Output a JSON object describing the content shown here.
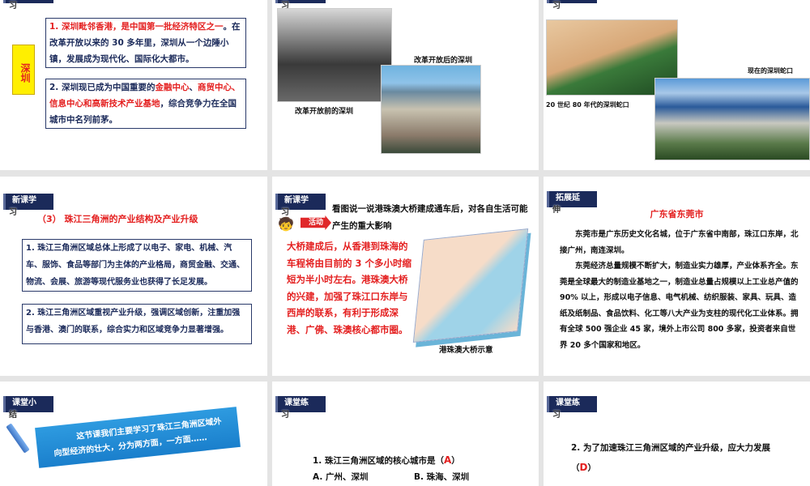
{
  "slide1": {
    "badge2": "习",
    "side_label": "深圳",
    "p1_red": "1. 深圳毗邻香港，是中国第一批经济特区之一",
    "p1_rest": "。在改革开放以来的 30 多年里，深圳从一个边陲小镇，发展成为现代化、国际化大都市。",
    "p2_a": "2. 深圳现已成为中国重要的",
    "p2_red1": "金融中心",
    "p2_b": "、",
    "p2_red2": "商贸中心、信息中心和高新技术产业基地",
    "p2_c": "，综合竞争力在全国城市中名列前茅。"
  },
  "slide2": {
    "badge2": "习",
    "cap_before": "改革开放前的深圳",
    "cap_after": "改革开放后的深圳"
  },
  "slide3": {
    "badge2": "习",
    "cap_80s": "20 世纪 80 年代的深圳蛇口",
    "cap_now": "现在的深圳蛇口"
  },
  "slide4": {
    "badge1": "新课学",
    "badge2": "习",
    "title": "（3） 珠江三角洲的产业结构及产业升级",
    "p1": "1. 珠江三角洲区域总体上形成了以电子、家电、机械、汽车、服饰、食品等部门为主体的产业格局，商贸金融、交通、物流、会展、旅游等现代服务业也获得了长足发展。",
    "p2": "2. 珠江三角洲区域重视产业升级，强调区域创新，注重加强与香港、澳门的联系，综合实力和区域竞争力显著增强。"
  },
  "slide5": {
    "badge1": "新课学",
    "badge2": "习",
    "activity": "活动",
    "prompt": "看图说一说港珠澳大桥建成通车后，对各自生活可能产生的重大影响",
    "answer": "大桥建成后，从香港到珠海的车程将由目前的 3 个多小时缩短为半小时左右。港珠澳大桥的兴建，加强了珠江口东岸与西岸的联系，有利于形成深港、广佛、珠澳核心都市圈。",
    "map_caption": "港珠澳大桥示意"
  },
  "slide6": {
    "badge1": "拓展延",
    "badge2": "伸",
    "title": "广东省东莞市",
    "p1": "东莞市是广东历史文化名城，位于广东省中南部，珠江口东岸，北接广州，南连深圳。",
    "p2": "东莞经济总量规模不断扩大，制造业实力雄厚，产业体系齐全。东莞是全球最大的制造业基地之一，制造业总量占规模以上工业总产值的 90% 以上，形成以电子信息、电气机械、纺织服装、家具、玩具、造纸及纸制品、食品饮料、化工等八大产业为支柱的现代化工业体系。拥有全球 500 强企业 45 家，境外上市公司 800 多家，投资者来自世界 20 多个国家和地区。"
  },
  "slide7": {
    "badge1": "课堂小",
    "badge2": "结",
    "summary": "这节课我们主要学习了珠江三角洲区域外向型经济的壮大，分为两方面，一方面……"
  },
  "slide8": {
    "badge1": "课堂练",
    "badge2": "习",
    "q": "1. 珠江三角洲区域的核心城市是（",
    "q_end": "）",
    "answer": "A",
    "optA": "A. 广州、深圳",
    "optB": "B. 珠海、深圳"
  },
  "slide9": {
    "badge1": "课堂练",
    "badge2": "习",
    "q": "2. 为了加速珠江三角洲区域的产业升级，应大力发展（",
    "q_end": "）",
    "answer": "D"
  }
}
